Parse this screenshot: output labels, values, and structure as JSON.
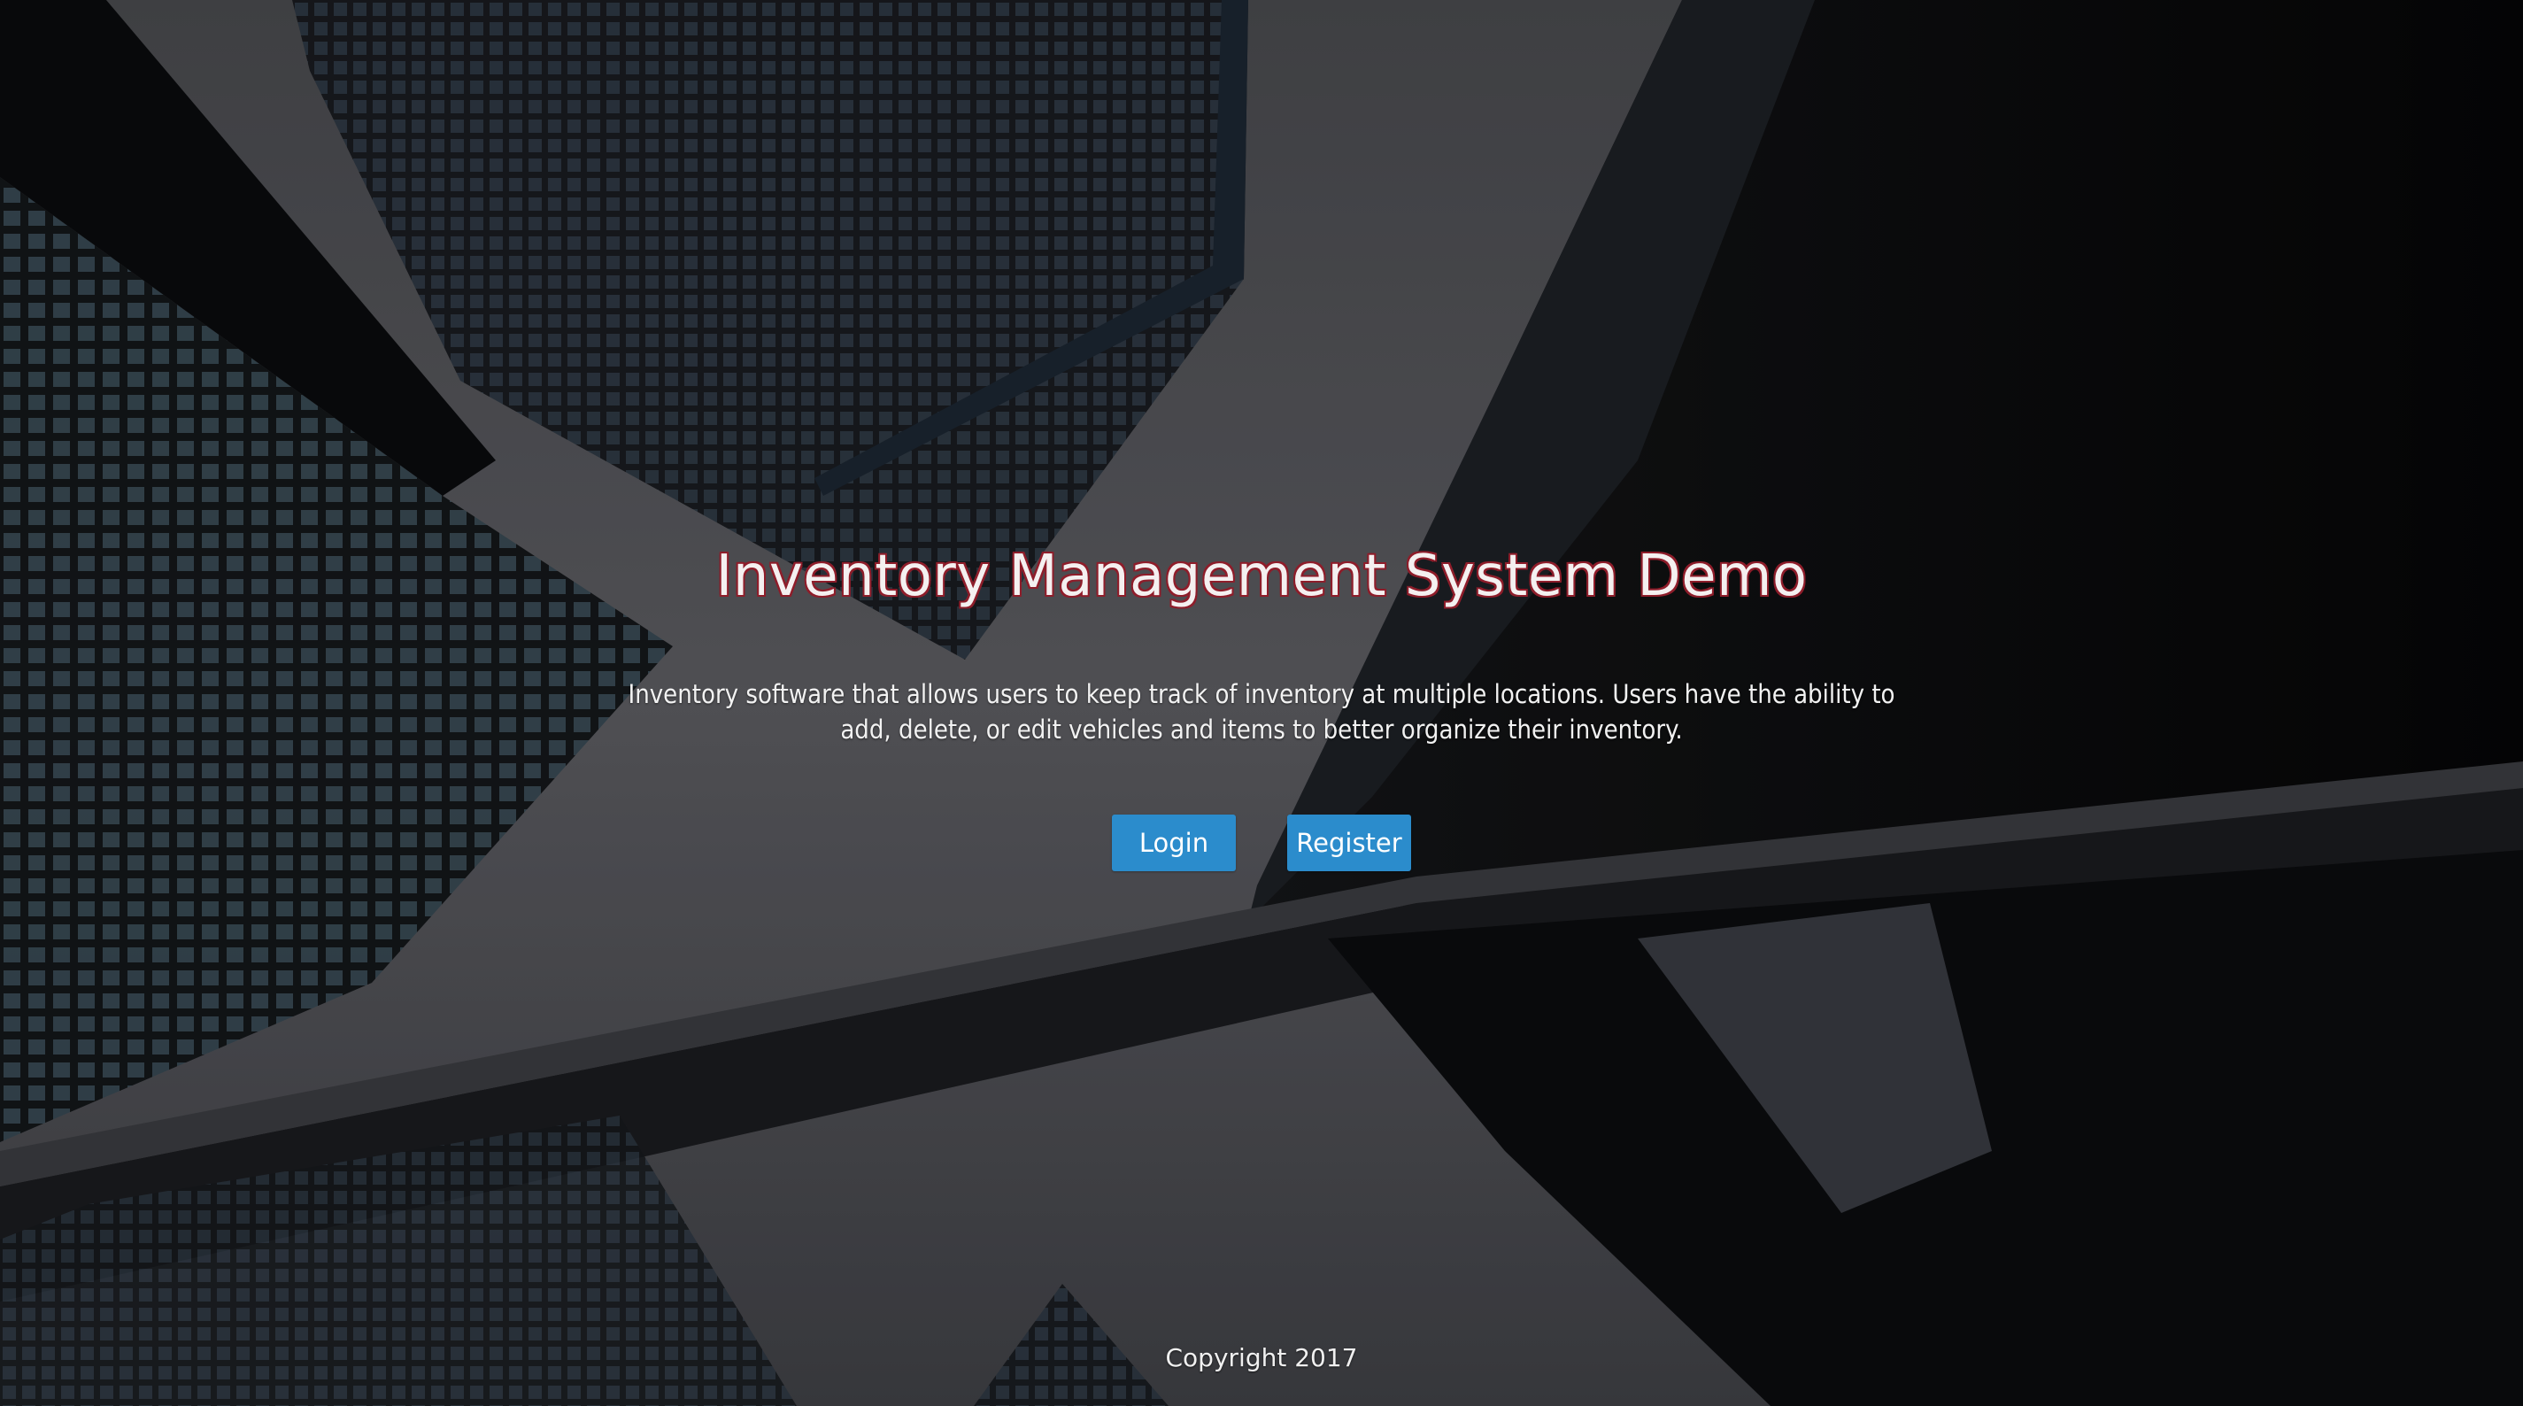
{
  "hero": {
    "title": "Inventory Management System Demo",
    "description": "Inventory software that allows users to keep track of inventory at multiple locations. Users have the ability to add, delete, or edit vehicles and items to better organize their inventory."
  },
  "actions": {
    "login_label": "Login",
    "register_label": "Register"
  },
  "footer": {
    "copyright": "Copyright 2017"
  },
  "colors": {
    "button": "#2b8ccc",
    "title_outline": "#8e1d2a",
    "text": "#f2f2f2"
  }
}
